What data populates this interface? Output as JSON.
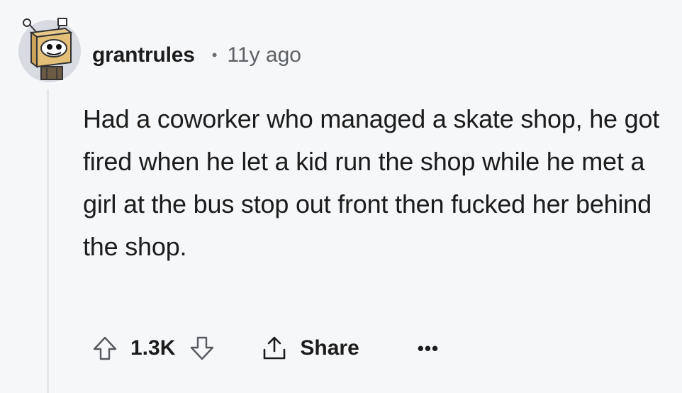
{
  "comment": {
    "username": "grantrules",
    "separator": "•",
    "timestamp": "11y ago",
    "body": "Had a coworker who managed a skate shop, he got fired when he let a kid run the shop while he met a girl at the bus stop out front then fucked her behind the shop."
  },
  "actions": {
    "upvote_icon": "upvote-arrow-icon",
    "vote_count": "1.3K",
    "downvote_icon": "downvote-arrow-icon",
    "share_icon": "share-icon",
    "share_label": "Share",
    "more_label": "•••"
  },
  "colors": {
    "background": "#f6f7f9",
    "text": "#1c1c1c",
    "muted": "#5c6166",
    "thread_line": "#e3e6ea"
  }
}
